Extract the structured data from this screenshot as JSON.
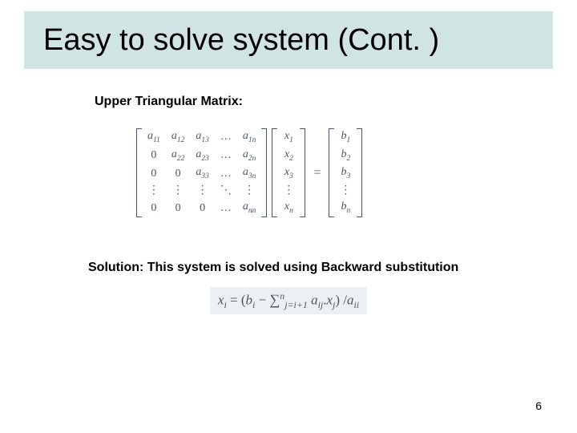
{
  "title": "Easy to solve system (Cont. )",
  "subhead1": "Upper Triangular Matrix:",
  "subhead2": "Solution: This system is solved using Backward substitution",
  "page_number": "6",
  "matrix": {
    "A": [
      [
        "a|11",
        "a|12",
        "a|13",
        "…",
        "a|1n"
      ],
      [
        "0",
        "a|22",
        "a|23",
        "…",
        "a|2n"
      ],
      [
        "0",
        "0",
        "a|33",
        "…",
        "a|3n"
      ],
      [
        "⋮",
        "⋮",
        "⋮",
        "⋱",
        "⋮"
      ],
      [
        "0",
        "0",
        "0",
        "…",
        "a|nn"
      ]
    ],
    "x": [
      "x|1",
      "x|2",
      "x|3",
      "⋮",
      "x|n"
    ],
    "b": [
      "b|1",
      "b|2",
      "b|3",
      "⋮",
      "b|n"
    ]
  },
  "formula": {
    "lhs_var": "x",
    "lhs_sub": "i",
    "b_var": "b",
    "b_sub": "i",
    "sum_lower": "j=i+1",
    "sum_upper": "n",
    "a_var": "a",
    "a_sub": "ij",
    "x_var": "x",
    "x_sub": "j",
    "denom_var": "a",
    "denom_sub": "ii"
  }
}
